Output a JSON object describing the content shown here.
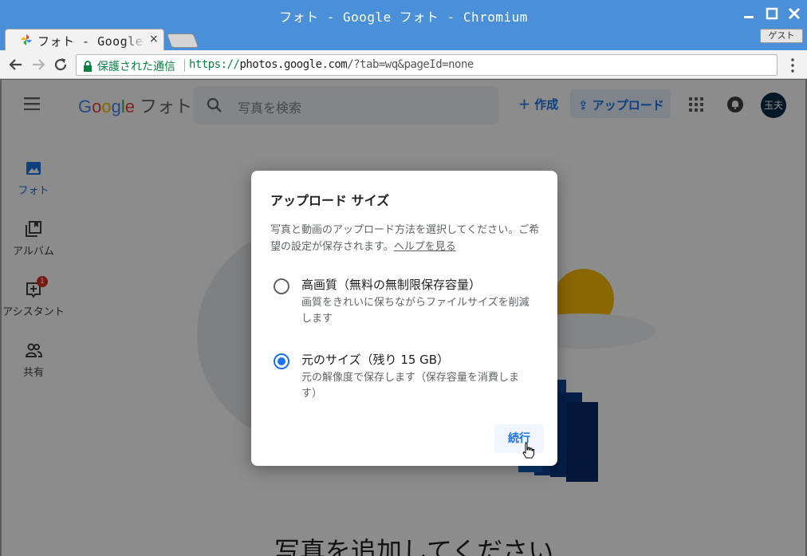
{
  "window": {
    "title": "フォト - Google フォト - Chromium"
  },
  "tab": {
    "title": "フォト - Google フォト",
    "close": "×"
  },
  "profile": {
    "label": "ゲスト"
  },
  "omnibox": {
    "security_label": "保護された通信",
    "url_scheme": "https://",
    "url_host": "photos.google.com",
    "url_path": "/?tab=wq&pageId=none"
  },
  "app": {
    "logo": {
      "g1": "G",
      "g2": "o",
      "g3": "o",
      "g4": "g",
      "g5": "l",
      "g6": "e",
      "product": "フォト"
    },
    "search_placeholder": "写真を検索",
    "create_label": "作成",
    "upload_label": "アップロード",
    "avatar_initials": "玉夫"
  },
  "sidenav": {
    "items": [
      {
        "label": "フォト",
        "icon": "photo-icon"
      },
      {
        "label": "アルバム",
        "icon": "album-icon"
      },
      {
        "label": "アシスタント",
        "icon": "assistant-icon",
        "badge": "1"
      },
      {
        "label": "共有",
        "icon": "people-icon"
      }
    ]
  },
  "empty_state": {
    "title": "写真を追加してください"
  },
  "dialog": {
    "title": "アップロード サイズ",
    "description": "写真と動画のアップロード方法を選択してください。ご希望の設定が保存されます。",
    "help_link": "ヘルプを見る",
    "options": [
      {
        "label": "高画質（無料の無制限保存容量）",
        "sub": "画質をきれいに保ちながらファイルサイズを削減します",
        "selected": false
      },
      {
        "label": "元のサイズ（残り 15 GB）",
        "sub": "元の解像度で保存します（保存容量を消費します）",
        "selected": true
      }
    ],
    "continue_label": "続行"
  },
  "colors": {
    "accent": "#1a73e8",
    "secure": "#0b8043",
    "titlebar": "#4a90d9"
  }
}
